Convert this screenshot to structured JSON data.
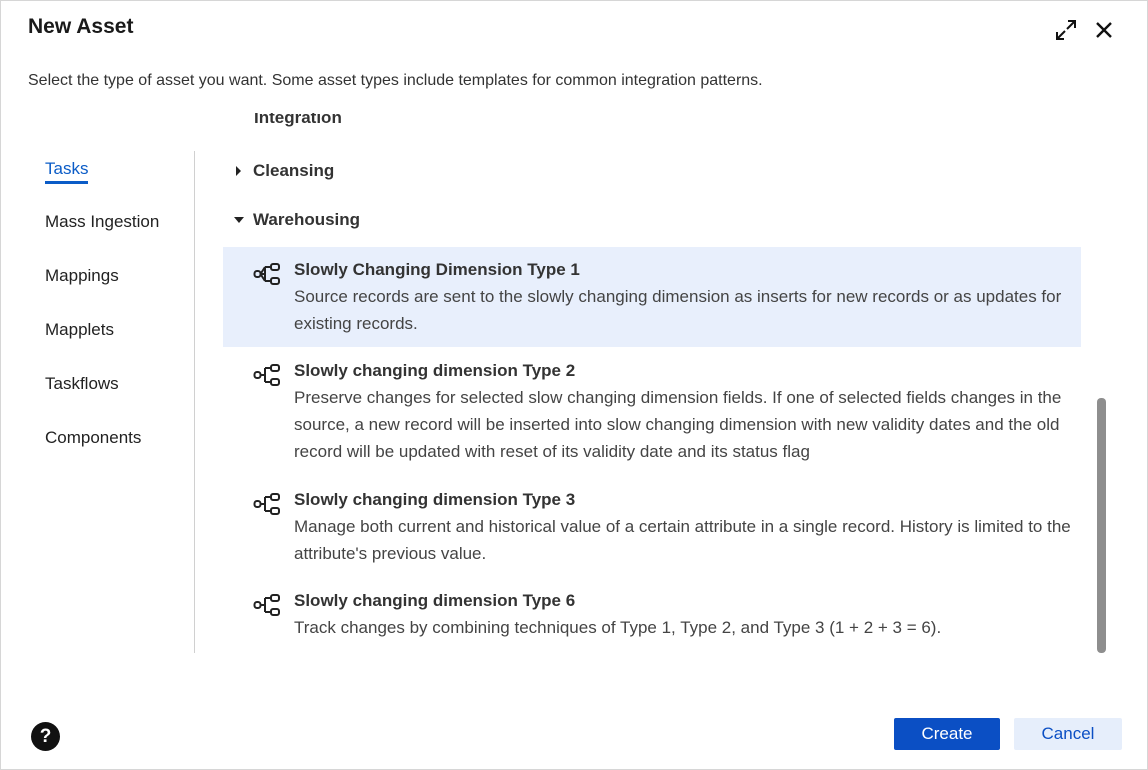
{
  "dialog": {
    "title": "New Asset",
    "subtitle": "Select the type of asset you want. Some asset types include templates for common integration patterns."
  },
  "nav": {
    "items": [
      {
        "label": "Tasks",
        "active": true
      },
      {
        "label": "Mass Ingestion"
      },
      {
        "label": "Mappings"
      },
      {
        "label": "Mapplets"
      },
      {
        "label": "Taskflows"
      },
      {
        "label": "Components"
      }
    ]
  },
  "content": {
    "cut_off_label": "Integration",
    "categories": [
      {
        "label": "Cleansing",
        "expanded": false
      },
      {
        "label": "Warehousing",
        "expanded": true
      }
    ],
    "items": [
      {
        "name": "Slowly Changing Dimension Type 1",
        "desc": "Source records are sent to the slowly changing dimension as inserts for new records or as updates for existing records.",
        "selected": true,
        "icon": "mapping-tree-icon"
      },
      {
        "name": "Slowly changing dimension Type 2",
        "desc": "Preserve changes for selected slow changing dimension fields. If one of selected fields changes in the source, a new record will be inserted into slow changing dimension with new validity dates and the old record will be updated with reset of its validity date and its status flag",
        "icon": "mapping-tree-icon"
      },
      {
        "name": "Slowly changing dimension Type 3",
        "desc": "Manage both current and historical value of a certain attribute in a single record. History is limited to the attribute's previous value.",
        "icon": "mapping-tree-icon"
      },
      {
        "name": "Slowly changing dimension Type 6",
        "desc": "Track changes by combining techniques of Type 1, Type 2, and Type 3 (1 + 2 + 3 = 6).",
        "icon": "mapping-tree-icon"
      }
    ]
  },
  "footer": {
    "help": "?",
    "create_label": "Create",
    "cancel_label": "Cancel"
  },
  "colors": {
    "accent": "#0b4fc4",
    "selected_bg": "#e8effc"
  }
}
